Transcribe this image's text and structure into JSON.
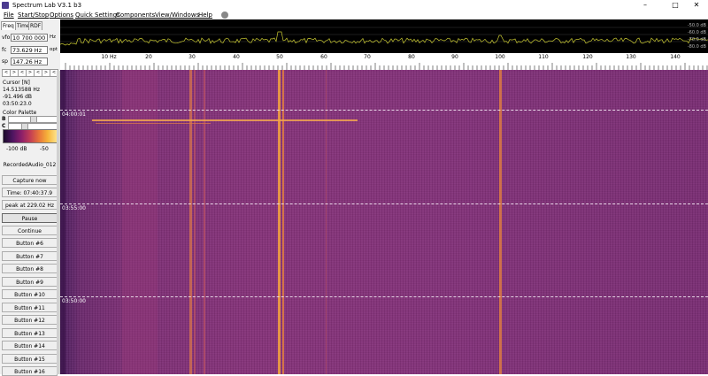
{
  "window": {
    "title": "Spectrum Lab V3.1 b3",
    "minimize": "–",
    "maximize": "□",
    "close": "✕"
  },
  "menu": {
    "items": [
      "File",
      "Start/Stop",
      "Options",
      "Quick Settings",
      "Components",
      "View/Windows",
      "Help"
    ]
  },
  "tabs": [
    "Freq",
    "Time",
    "RDF"
  ],
  "fields": {
    "vfo_label": "vfo",
    "vfo_value": "10 700 000",
    "vfo_unit": "Hz",
    "fc_label": "fc",
    "fc_value": "73.629 Hz",
    "fc_unit": "opt",
    "sp_label": "sp",
    "sp_value": "147.26 Hz"
  },
  "arrow_buttons": [
    "<",
    ">",
    "<",
    ">",
    "<",
    ">",
    "<"
  ],
  "cursor": {
    "title": "Cursor [N]",
    "freq": "14.513588 Hz",
    "level": "-91.496 dB",
    "time": "03:50:23.0"
  },
  "palette": {
    "title": "Color Palette",
    "b_label": "B",
    "c_label": "C",
    "min": "-100 dB",
    "max": "-50"
  },
  "status": {
    "recorded": "RecordedAudio_012",
    "time": "Time:  07:40:37.9",
    "peak": "peak at 229.02 Hz"
  },
  "buttons": {
    "capture": "Capture now",
    "pause": "Pause",
    "continue": "Continue",
    "list": [
      "Button #6",
      "Button #7",
      "Button #8",
      "Button #9",
      "Button #10",
      "Button #11",
      "Button #12",
      "Button #13",
      "Button #14",
      "Button #15",
      "Button #16"
    ]
  },
  "spectrum": {
    "db_labels": [
      "-50.0 dB",
      "-60.0 dB",
      "-70.0 dB",
      "-80.0 dB"
    ]
  },
  "freq_axis": {
    "ticks": [
      "10 Hz",
      "20",
      "30",
      "40",
      "50",
      "60",
      "70",
      "80",
      "90",
      "100",
      "110",
      "120",
      "130",
      "140"
    ]
  },
  "waterfall": {
    "time_labels": [
      "04:00:01",
      "03:55:00",
      "03:50:00"
    ]
  },
  "colors": {
    "waterfall_base": "#83317a",
    "line_bright": "#f0a040",
    "spectrum_trace": "#c8c832"
  }
}
